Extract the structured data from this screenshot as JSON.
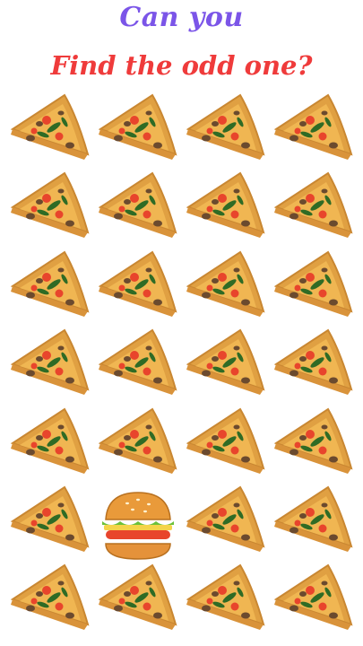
{
  "header": {
    "line1": "Can you",
    "line2": "Find the odd one?"
  },
  "colors": {
    "line1": "#7b55e8",
    "line2": "#ef3b3b",
    "crust": "#e0a042",
    "cheese": "#f0b652",
    "tomato": "#e8452c",
    "basil": "#2f6b25",
    "meat": "#6b4a2e"
  },
  "puzzle": {
    "rows": 7,
    "columns": 4,
    "common_item": "pizza-slice-icon",
    "odd_item": "burger-icon",
    "odd_position": {
      "row": 6,
      "column": 2
    }
  }
}
